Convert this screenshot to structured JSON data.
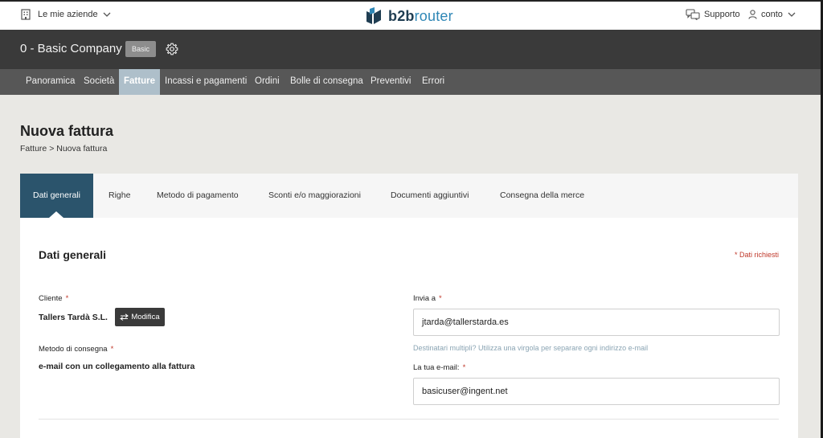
{
  "topbar": {
    "companies_label": "Le mie aziende",
    "logo_dark": "b2b",
    "logo_light": "router",
    "support_label": "Supporto",
    "account_label": "conto"
  },
  "company": {
    "name": "0 - Basic Company",
    "plan_badge": "Basic"
  },
  "nav": {
    "items": [
      "Panoramica",
      "Società",
      "Fatture",
      "Incassi e pagamenti",
      "Ordini",
      "Bolle di consegna",
      "Preventivi",
      "Errori"
    ],
    "active": "Fatture"
  },
  "page": {
    "title": "Nuova fattura",
    "breadcrumb": [
      "Fatture",
      "Nuova fattura"
    ]
  },
  "tabs": {
    "items": [
      "Dati generali",
      "Righe",
      "Metodo di pagamento",
      "Sconti e/o maggiorazioni",
      "Documenti aggiuntivi",
      "Consegna della merce"
    ],
    "active": "Dati generali"
  },
  "form": {
    "section_title": "Dati generali",
    "required_note": "* Dati richiesti",
    "client_label": "Cliente",
    "client_value": "Tallers Tardà S.L.",
    "modify_label": "Modifica",
    "delivery_label": "Metodo di consegna",
    "delivery_value": "e-mail con un collegamento alla fattura",
    "send_to_label": "Invia a",
    "send_to_value": "jtarda@tallerstarda.es",
    "send_to_hint": "Destinatari multipli? Utilizza una virgola per separare ogni indirizzo e-mail",
    "your_email_label": "La tua e-mail:",
    "your_email_value": "basicuser@ingent.net",
    "required_star": "*"
  },
  "colors": {
    "accent": "#2b546c",
    "required": "#c0392b",
    "nav_active": "#aebfca"
  },
  "icons": [
    "building-icon",
    "chevron-down-icon",
    "logo-icon",
    "chat-icon",
    "user-icon",
    "gear-icon",
    "swap-icon"
  ]
}
